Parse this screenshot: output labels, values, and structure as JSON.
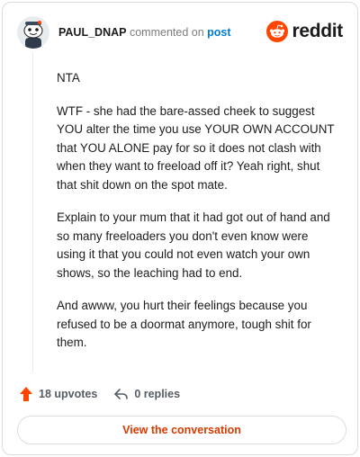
{
  "header": {
    "username": "PAUL_DNAP",
    "action": "commented on",
    "post_link": "post",
    "logo_text": "reddit"
  },
  "comment": {
    "paragraphs": [
      "NTA",
      "WTF - she had the bare-assed cheek to suggest YOU alter the time you use YOUR OWN ACCOUNT that YOU ALONE pay for so it does not clash with when they want to freeload off it? Yeah right, shut that shit down on the spot mate.",
      "Explain to your mum that it had got out of hand and so many freeloaders you don't even know were using it that you could not even watch your own shows, so the leaching had to end.",
      "And awww, you hurt their feelings because you refused to be a doormat anymore, tough shit for them."
    ]
  },
  "footer": {
    "upvotes_label": "18 upvotes",
    "replies_label": "0 replies",
    "view_conversation_label": "View the conversation"
  },
  "colors": {
    "brand_orange": "#ff4500",
    "cta_text": "#d93a00",
    "link_blue": "#0079d3"
  },
  "icons": {
    "avatar": "snoo-avatar-icon",
    "logo": "reddit-logo-icon",
    "upvote": "upvote-arrow-icon",
    "reply": "reply-arrow-icon"
  }
}
